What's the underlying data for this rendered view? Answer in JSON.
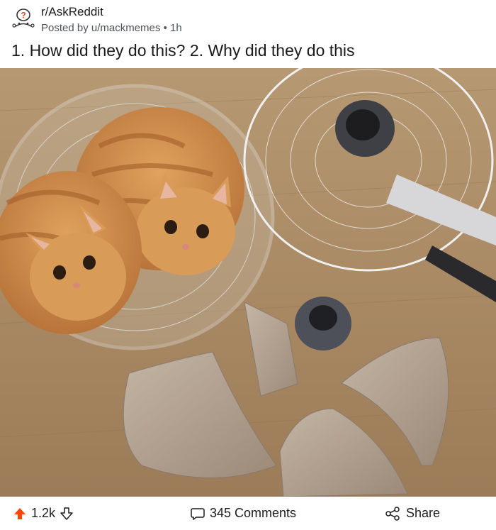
{
  "post": {
    "subreddit": "r/AskReddit",
    "meta": "Posted by u/mackmemes • 1h",
    "title": "1. How did they do this? 2. Why did they do this"
  },
  "image": {
    "subject": "two-orange-cats-in-fan-cage"
  },
  "actions": {
    "upvotes": "1.2k",
    "comments": "345 Comments",
    "share": "Share"
  },
  "colors": {
    "upvote": "#ff4500",
    "text": "#1c1c1c",
    "meta": "#4f5358"
  }
}
